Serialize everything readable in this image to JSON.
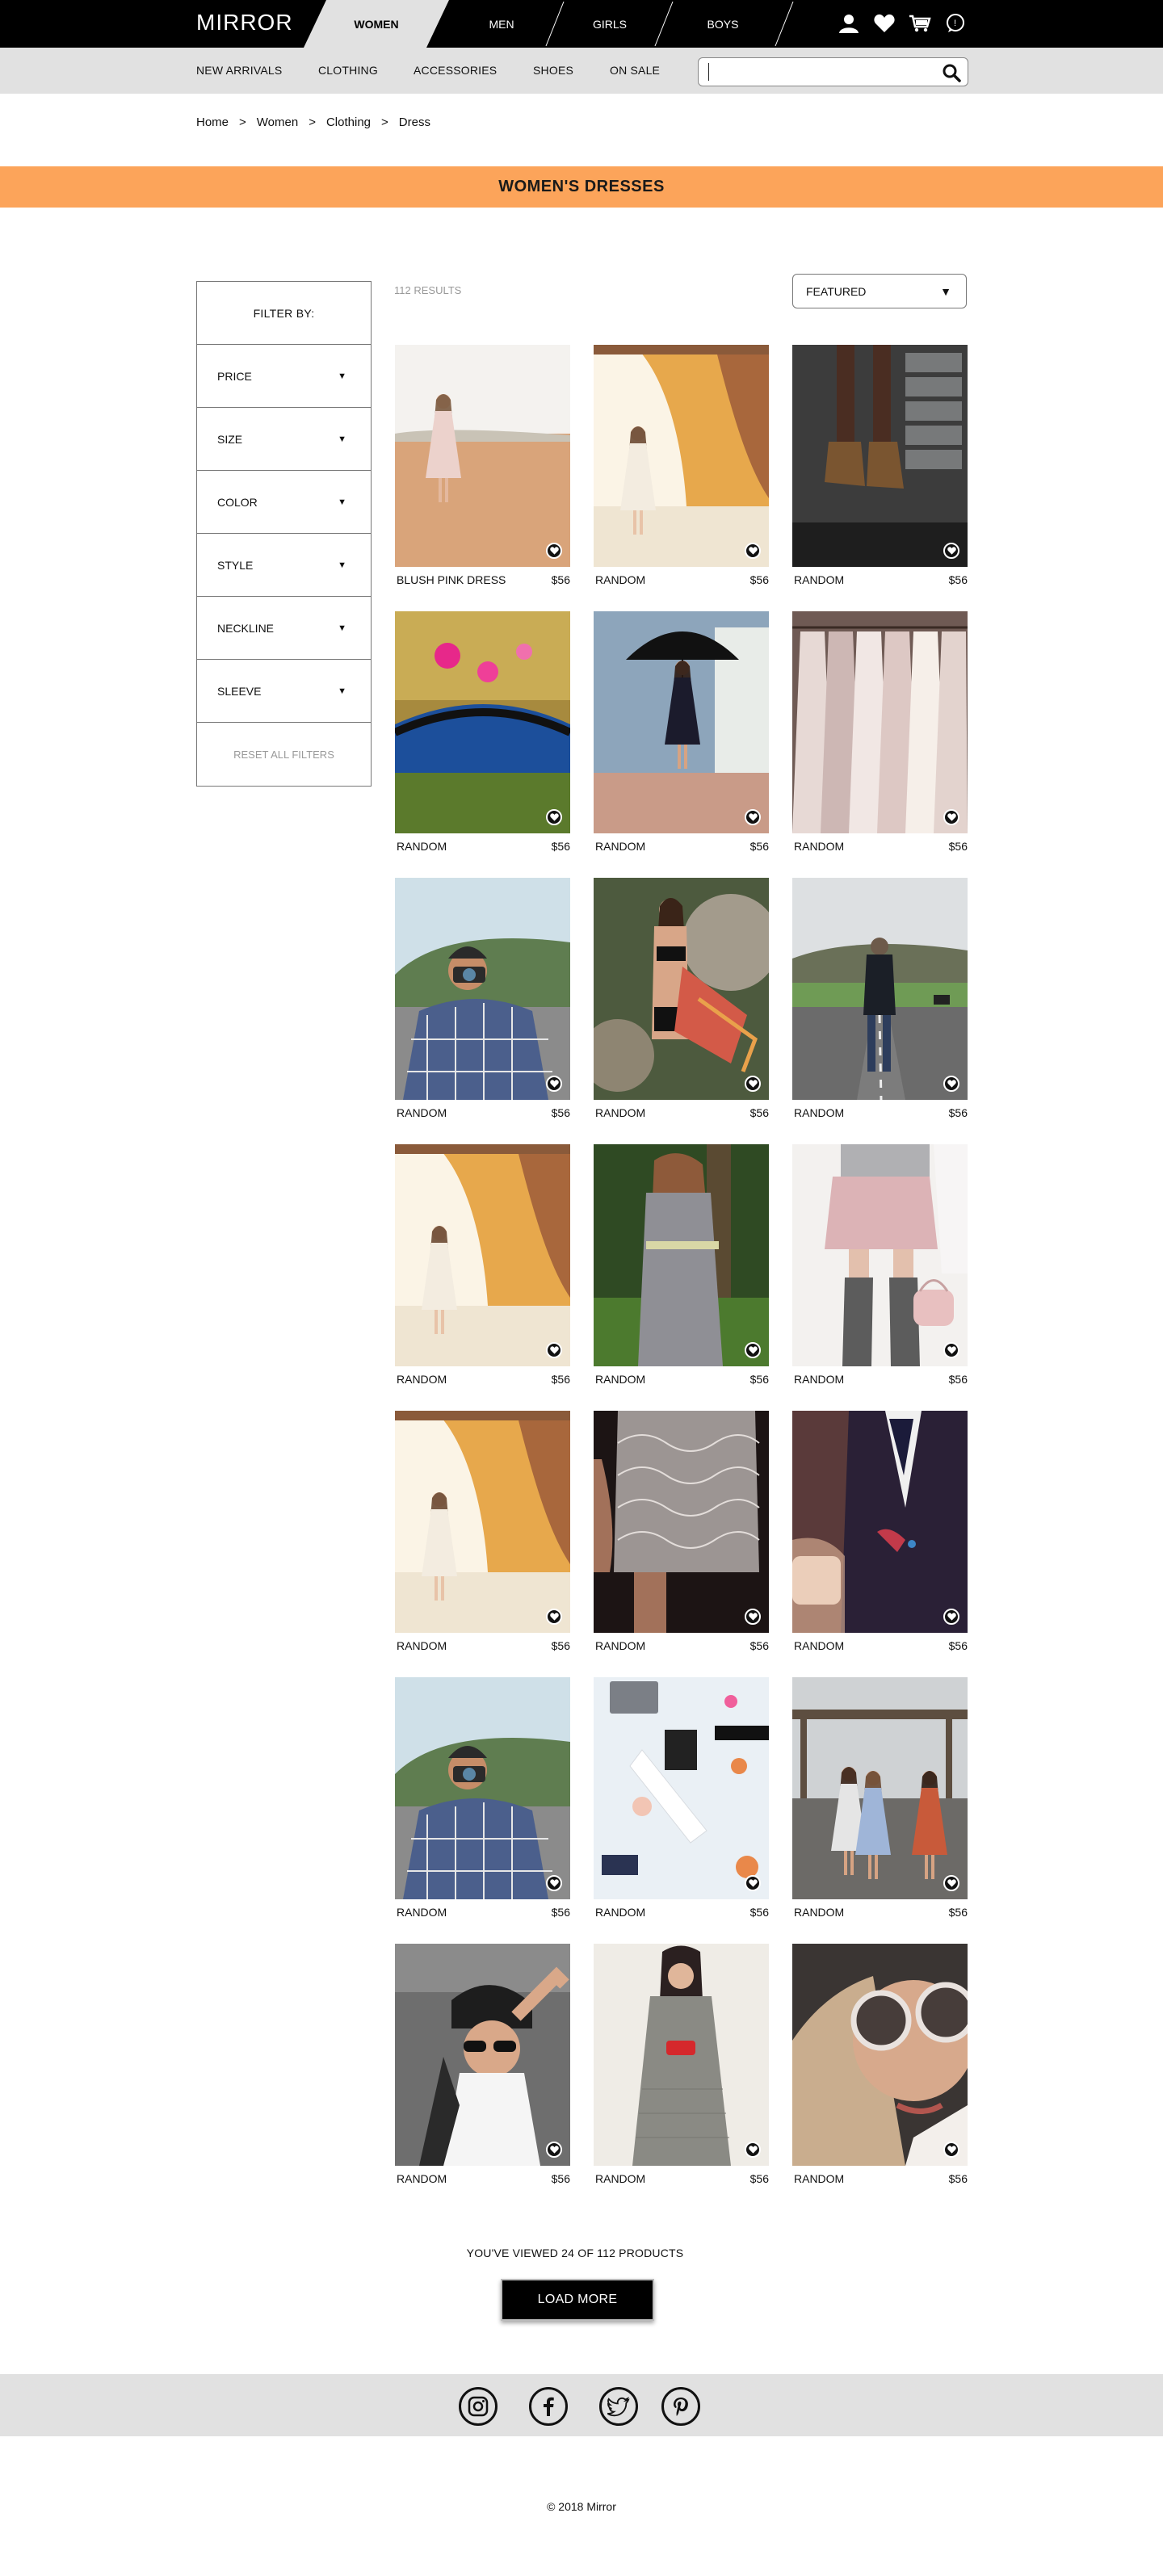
{
  "brand": "MIRROR",
  "gender_tabs": [
    {
      "label": "WOMEN",
      "active": true
    },
    {
      "label": "MEN",
      "active": false
    },
    {
      "label": "GIRLS",
      "active": false
    },
    {
      "label": "BOYS",
      "active": false
    }
  ],
  "nav_icons": [
    "account-icon",
    "heart-icon",
    "cart-icon",
    "chat-icon"
  ],
  "categories": [
    "NEW ARRIVALS",
    "CLOTHING",
    "ACCESSORIES",
    "SHOES",
    "ON SALE"
  ],
  "search": {
    "placeholder": "",
    "value": ""
  },
  "breadcrumb": [
    "Home",
    "Women",
    "Clothing",
    "Dress"
  ],
  "breadcrumb_separator": ">",
  "banner_title": "WOMEN'S DRESSES",
  "accent_color": "#fca45a",
  "filter": {
    "heading": "FILTER BY:",
    "options": [
      "PRICE",
      "SIZE",
      "COLOR",
      "STYLE",
      "NECKLINE",
      "SLEEVE"
    ],
    "reset_label": "RESET ALL FILTERS"
  },
  "results_count": "112 RESULTS",
  "sort": {
    "selected": "FEATURED"
  },
  "products": [
    {
      "name": "BLUSH PINK DRESS",
      "price": "$56",
      "image": "woman-in-pink-dress-field"
    },
    {
      "name": "RANDOM",
      "price": "$56",
      "image": "bride-curtain-window"
    },
    {
      "name": "RANDOM",
      "price": "$56",
      "image": "legs-boots-lockers"
    },
    {
      "name": "RANDOM",
      "price": "$56",
      "image": "pink-flowers-blue-bag"
    },
    {
      "name": "RANDOM",
      "price": "$56",
      "image": "woman-with-umbrella"
    },
    {
      "name": "RANDOM",
      "price": "$56",
      "image": "white-dresses-on-rack"
    },
    {
      "name": "RANDOM",
      "price": "$56",
      "image": "man-with-camera-plaid"
    },
    {
      "name": "RANDOM",
      "price": "$56",
      "image": "woman-in-bikini-rocks"
    },
    {
      "name": "RANDOM",
      "price": "$56",
      "image": "man-on-road"
    },
    {
      "name": "RANDOM",
      "price": "$56",
      "image": "bride-curtain-window"
    },
    {
      "name": "RANDOM",
      "price": "$56",
      "image": "woman-grey-dress-forest"
    },
    {
      "name": "RANDOM",
      "price": "$56",
      "image": "pink-skirt-boots-bag"
    },
    {
      "name": "RANDOM",
      "price": "$56",
      "image": "bride-curtain-window"
    },
    {
      "name": "RANDOM",
      "price": "$56",
      "image": "lace-dress-closeup"
    },
    {
      "name": "RANDOM",
      "price": "$56",
      "image": "man-waistcoat-coffee"
    },
    {
      "name": "RANDOM",
      "price": "$56",
      "image": "man-with-camera-plaid"
    },
    {
      "name": "RANDOM",
      "price": "$56",
      "image": "flatlay-laptop-desk"
    },
    {
      "name": "RANDOM",
      "price": "$56",
      "image": "women-walking-station"
    },
    {
      "name": "RANDOM",
      "price": "$56",
      "image": "woman-beanie-sunglasses"
    },
    {
      "name": "RANDOM",
      "price": "$56",
      "image": "woman-grey-dress-red-clutch"
    },
    {
      "name": "RANDOM",
      "price": "$56",
      "image": "woman-round-sunglasses"
    }
  ],
  "viewed_text": "YOU'VE VIEWED 24 OF 112 PRODUCTS",
  "load_more_label": "LOAD MORE",
  "social_icons": [
    "instagram-icon",
    "facebook-icon",
    "twitter-icon",
    "pinterest-icon"
  ],
  "copyright": "© 2018 Mirror"
}
